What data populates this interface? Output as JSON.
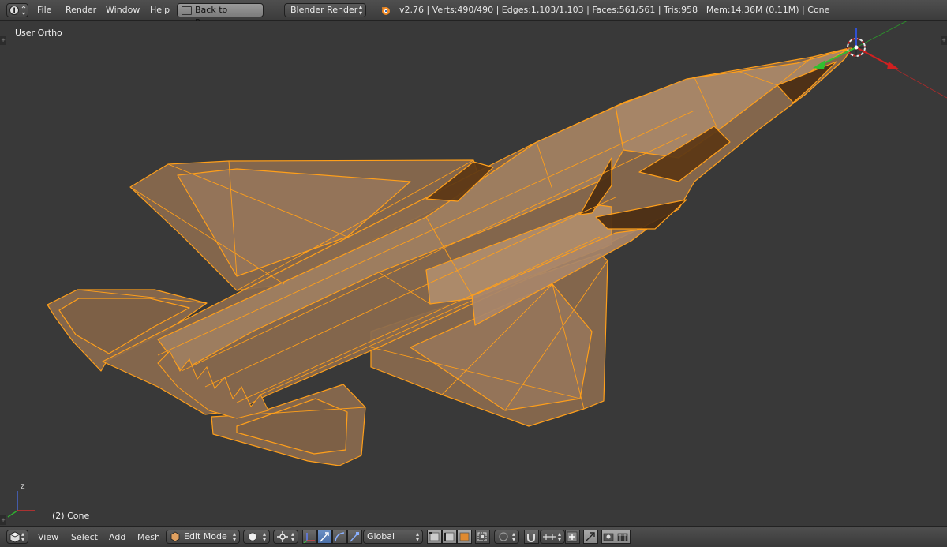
{
  "top_bar": {
    "menus": [
      "File",
      "Render",
      "Window",
      "Help"
    ],
    "back_button": "Back to Previous",
    "render_engine": "Blender Render",
    "stats": "v2.76 | Verts:490/490 | Edges:1,103/1,103 | Faces:561/561 | Tris:958 | Mem:14.36M (0.11M) | Cone"
  },
  "viewport": {
    "view_label": "User Ortho",
    "object_label": "(2) Cone",
    "axis_label": "Z"
  },
  "bottom_bar": {
    "menus": [
      "View",
      "Select",
      "Add",
      "Mesh"
    ],
    "mode": "Edit Mode",
    "orientation": "Global"
  },
  "colors": {
    "mesh_fill": "#8a6a4e",
    "mesh_edge": "#ff9f1a",
    "background": "#393939",
    "header": "#474747",
    "x_axis": "#d02020",
    "y_axis": "#30c030",
    "z_axis": "#3050d0"
  },
  "icons": [
    "info-icon",
    "blender-logo-icon",
    "editor-type-icon",
    "viewport-shading-icon",
    "pivot-icon",
    "manipulator-icon",
    "translate-icon",
    "rotate-icon",
    "scale-icon",
    "vertex-select-icon",
    "edge-select-icon",
    "face-select-icon",
    "limit-visible-icon",
    "proportional-edit-icon",
    "snap-icon",
    "snap-target-icon",
    "render-icon",
    "camera-icon"
  ]
}
